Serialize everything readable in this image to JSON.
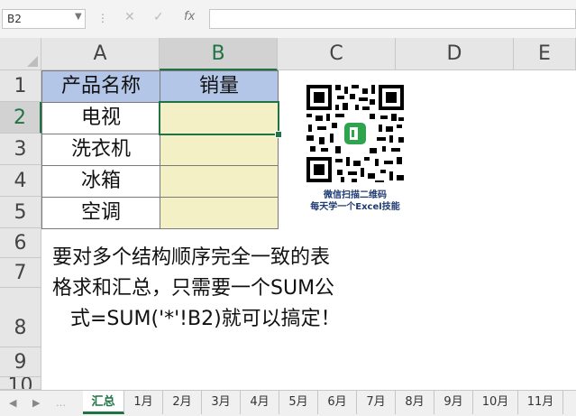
{
  "formula_bar": {
    "name_box": "B2",
    "cancel_icon": "✕",
    "enter_icon": "✓",
    "fx_label": "fx",
    "formula": ""
  },
  "columns": [
    "A",
    "B",
    "C",
    "D",
    "E"
  ],
  "rows": [
    "1",
    "2",
    "3",
    "4",
    "5",
    "6",
    "7",
    "8",
    "9",
    "10"
  ],
  "table": {
    "headers": [
      "产品名称",
      "销量"
    ],
    "products": [
      "电视",
      "洗衣机",
      "冰箱",
      "空调"
    ]
  },
  "qr": {
    "caption_line1": "微信扫描二维码",
    "caption_line2": "每天学一个Excel技能"
  },
  "note": {
    "line1": "要对多个结构顺序完全一致的表",
    "line2": "格求和汇总，只需要一个SUM公",
    "line3": "式=SUM('*'!B2)就可以搞定！"
  },
  "sheet_tabs": [
    "汇总",
    "1月",
    "2月",
    "3月",
    "4月",
    "5月",
    "6月",
    "7月",
    "8月",
    "9月",
    "10月",
    "11月"
  ],
  "active_sheet": "汇总",
  "colors": {
    "accent": "#217346",
    "header_fill": "#b4c6e7",
    "input_fill": "#f2f0c4"
  }
}
